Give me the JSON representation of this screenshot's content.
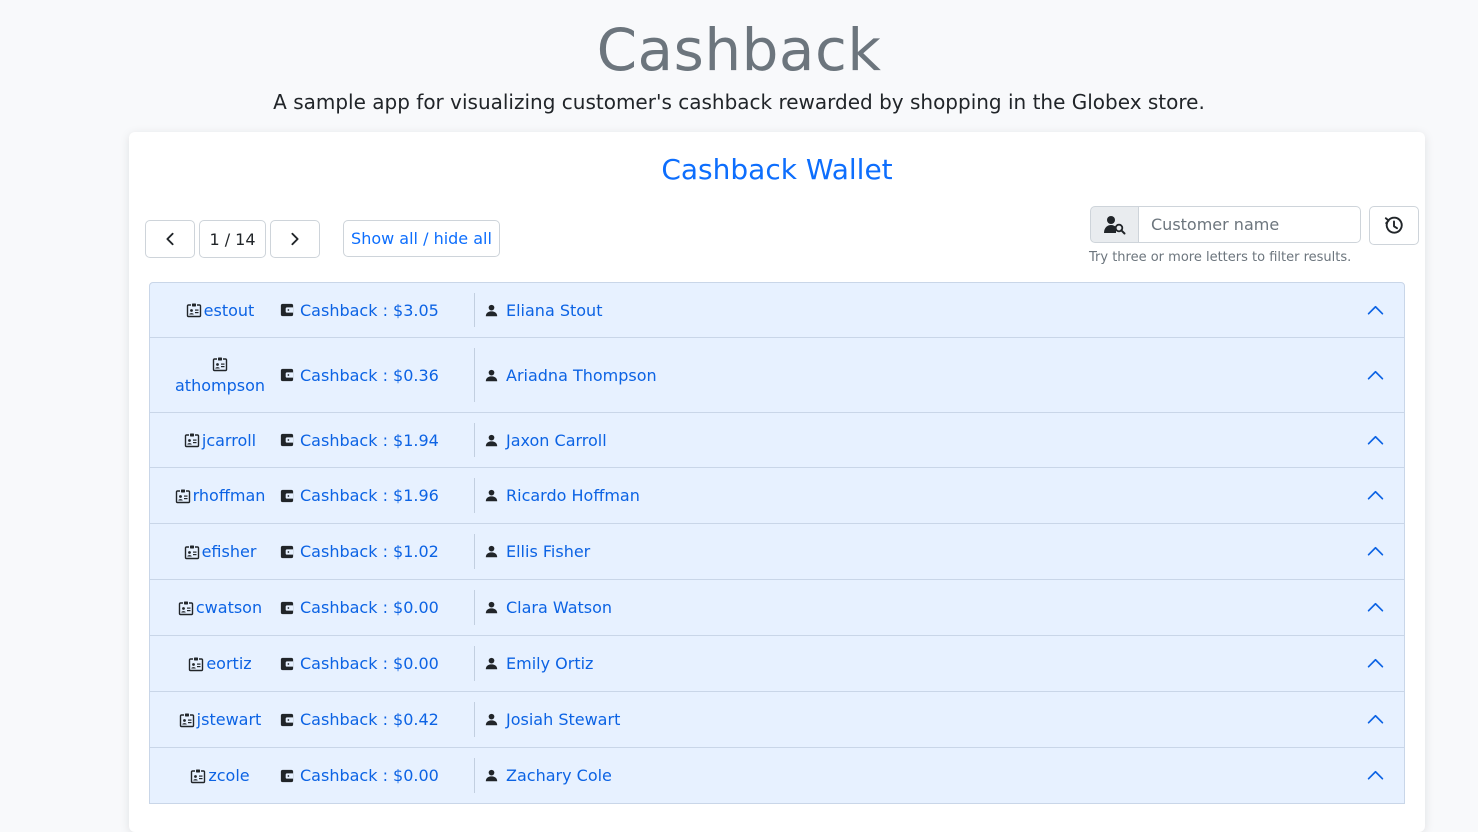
{
  "header": {
    "title": "Cashback",
    "subtitle": "A sample app for visualizing customer's cashback rewarded by shopping in the Globex store."
  },
  "wallet": {
    "title": "Cashback Wallet",
    "pagination": {
      "indicator": "1 / 14"
    },
    "show_all_label": "Show all / hide all",
    "search": {
      "placeholder": "Customer name",
      "value": "",
      "hint": "Try three or more letters to filter results."
    },
    "rows": [
      {
        "user": "estout",
        "cashback": "Cashback : $3.05",
        "name": "Eliana Stout"
      },
      {
        "user": "athompson",
        "cashback": "Cashback : $0.36",
        "name": "Ariadna Thompson"
      },
      {
        "user": "jcarroll",
        "cashback": "Cashback : $1.94",
        "name": "Jaxon Carroll"
      },
      {
        "user": "rhoffman",
        "cashback": "Cashback : $1.96",
        "name": "Ricardo Hoffman"
      },
      {
        "user": "efisher",
        "cashback": "Cashback : $1.02",
        "name": "Ellis Fisher"
      },
      {
        "user": "cwatson",
        "cashback": "Cashback : $0.00",
        "name": "Clara Watson"
      },
      {
        "user": "eortiz",
        "cashback": "Cashback : $0.00",
        "name": "Emily Ortiz"
      },
      {
        "user": "jstewart",
        "cashback": "Cashback : $0.42",
        "name": "Josiah Stewart"
      },
      {
        "user": "zcole",
        "cashback": "Cashback : $0.00",
        "name": "Zachary Cole"
      }
    ]
  },
  "icons": {
    "prev": "chevron-left-icon",
    "next": "chevron-right-icon",
    "search": "person-search-icon",
    "refresh": "refresh-clock-icon",
    "user": "id-badge-icon",
    "wallet": "wallet-icon",
    "person": "person-icon",
    "collapse": "chevron-up-icon"
  },
  "colors": {
    "accent": "#0d6efd",
    "row_bg": "#e7f1ff",
    "row_text": "#0c63e4",
    "muted": "#6c757d"
  }
}
